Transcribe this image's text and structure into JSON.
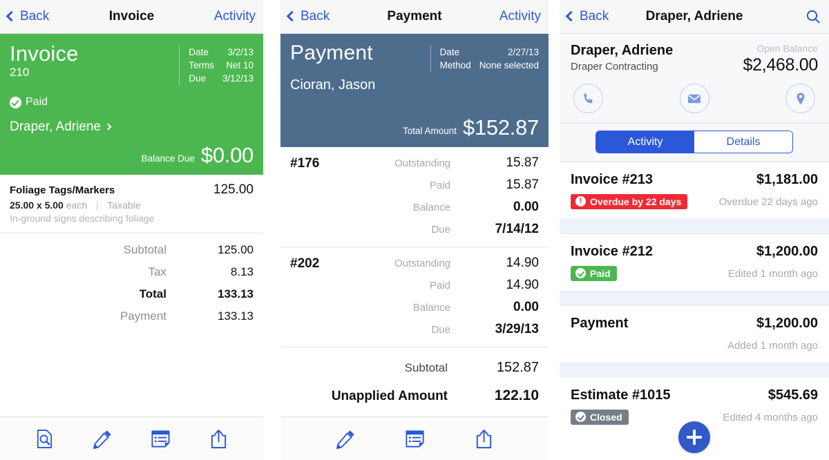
{
  "invoice_panel": {
    "nav": {
      "back": "Back",
      "title": "Invoice",
      "right": "Activity"
    },
    "header": {
      "type_label": "Invoice",
      "number": "210",
      "meta": [
        {
          "key": "Date",
          "value": "3/2/13"
        },
        {
          "key": "Terms",
          "value": "Net 10"
        },
        {
          "key": "Due",
          "value": "3/12/13"
        }
      ],
      "status": "Paid",
      "customer": "Draper, Adriene",
      "balance_label": "Balance Due",
      "balance_amount": "$0.00",
      "color": "#4CB750"
    },
    "line_items": [
      {
        "name": "Foliage Tags/Markers",
        "amount": "125.00",
        "qty_rate": "25.00 x 5.00",
        "each": "each",
        "taxable": "Taxable",
        "description": "In-ground signs describing foliage"
      }
    ],
    "totals": [
      {
        "key": "Subtotal",
        "value": "125.00",
        "bold": false,
        "muted": true
      },
      {
        "key": "Tax",
        "value": "8.13",
        "bold": false,
        "muted": true
      },
      {
        "key": "Total",
        "value": "133.13",
        "bold": true,
        "muted": false
      },
      {
        "key": "Payment",
        "value": "133.13",
        "bold": false,
        "muted": true
      }
    ],
    "toolbar": [
      {
        "icon": "document-search-icon"
      },
      {
        "icon": "pencil-edit-icon"
      },
      {
        "icon": "notes-list-icon"
      },
      {
        "icon": "share-export-icon"
      }
    ]
  },
  "payment_panel": {
    "nav": {
      "back": "Back",
      "title": "Payment",
      "right": "Activity"
    },
    "header": {
      "type_label": "Payment",
      "meta": [
        {
          "key": "Date",
          "value": "2/27/13"
        },
        {
          "key": "Method",
          "value": "None selected"
        }
      ],
      "payer": "Cioran, Jason",
      "total_label": "Total Amount",
      "total_amount": "$152.87",
      "color": "#4E6D8C"
    },
    "applied_rows": [
      {
        "id": "#176",
        "lines": [
          {
            "key": "Outstanding",
            "value": "15.87",
            "strong": false
          },
          {
            "key": "Paid",
            "value": "15.87",
            "strong": false
          },
          {
            "key": "Balance",
            "value": "0.00",
            "strong": true
          },
          {
            "key": "Due",
            "value": "7/14/12",
            "strong": true
          }
        ]
      },
      {
        "id": "#202",
        "lines": [
          {
            "key": "Outstanding",
            "value": "14.90",
            "strong": false
          },
          {
            "key": "Paid",
            "value": "14.90",
            "strong": false
          },
          {
            "key": "Balance",
            "value": "0.00",
            "strong": true
          },
          {
            "key": "Due",
            "value": "3/29/13",
            "strong": true
          }
        ]
      }
    ],
    "totals": [
      {
        "key": "Subtotal",
        "value": "152.87",
        "bold": false
      },
      {
        "key": "Unapplied Amount",
        "value": "122.10",
        "bold": true
      }
    ],
    "toolbar": [
      {
        "icon": "pencil-edit-icon"
      },
      {
        "icon": "notes-list-icon"
      },
      {
        "icon": "share-export-icon"
      }
    ]
  },
  "customer_panel": {
    "nav": {
      "back": "Back",
      "title": "Draper, Adriene",
      "right_icon": "search-icon"
    },
    "header": {
      "name": "Draper, Adriene",
      "company": "Draper Contracting",
      "open_balance_label": "Open Balance",
      "open_balance_amount": "$2,468.00",
      "actions": [
        {
          "icon": "phone-icon"
        },
        {
          "icon": "email-envelope-icon"
        },
        {
          "icon": "map-pin-icon"
        }
      ]
    },
    "segments": [
      {
        "label": "Activity",
        "active": true
      },
      {
        "label": "Details",
        "active": false
      }
    ],
    "activity": [
      {
        "title": "Invoice #213",
        "amount": "$1,181.00",
        "badge": {
          "text": "Overdue by 22 days",
          "style": "red"
        },
        "time": "Overdue 22 days ago"
      },
      {
        "title": "Invoice #212",
        "amount": "$1,200.00",
        "badge": {
          "text": "Paid",
          "style": "green"
        },
        "time": "Edited 1 month ago"
      },
      {
        "title": "Payment",
        "amount": "$1,200.00",
        "badge": null,
        "time": "Added 1 month ago"
      },
      {
        "title": "Estimate #1015",
        "amount": "$545.69",
        "badge": {
          "text": "Closed",
          "style": "grey"
        },
        "time": "Edited 4 months ago"
      }
    ],
    "fab": {
      "icon": "plus-icon"
    }
  },
  "colors": {
    "accent_blue": "#2b58d8",
    "paid_green": "#4CB750",
    "payment_slate": "#4E6D8C",
    "overdue_red": "#ee2b35",
    "closed_grey": "#757d89",
    "fab_blue": "#3159c8"
  }
}
